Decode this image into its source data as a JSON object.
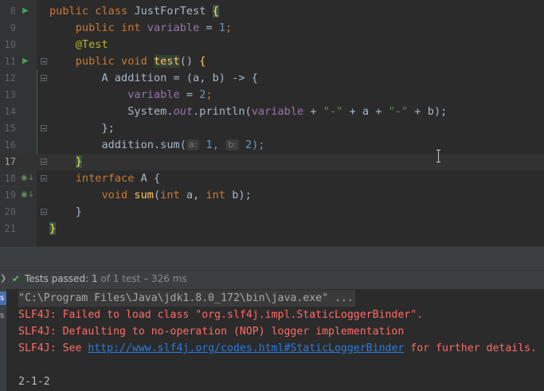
{
  "editor": {
    "lines": [
      {
        "no": "8",
        "gutter_icon": "run"
      },
      {
        "no": "9"
      },
      {
        "no": "10"
      },
      {
        "no": "11",
        "gutter_icon": "run"
      },
      {
        "no": "12"
      },
      {
        "no": "13"
      },
      {
        "no": "14"
      },
      {
        "no": "15"
      },
      {
        "no": "16"
      },
      {
        "no": "17",
        "current": true
      },
      {
        "no": "18",
        "gutter_icon": "implemented"
      },
      {
        "no": "19",
        "gutter_icon": "implemented"
      },
      {
        "no": "20"
      },
      {
        "no": "21"
      }
    ],
    "code": {
      "l8": {
        "kw1": "public",
        "kw2": "class",
        "name": "JustForTest",
        "brace": "{"
      },
      "l9": {
        "kw1": "public",
        "kw2": "int",
        "field": "variable",
        "op": " = ",
        "num": "1",
        "end": ";"
      },
      "l10": {
        "annotation": "@Test"
      },
      "l11": {
        "kw1": "public",
        "kw2": "void",
        "method": "test",
        "rest": "() ",
        "brace": "{"
      },
      "l12": {
        "text": "A addition = (a, b) -> {"
      },
      "l13": {
        "field": "variable",
        "op": " = ",
        "num": "2",
        "end": ";"
      },
      "l14": {
        "cls": "System.",
        "out": "out",
        "mid": ".println(",
        "field": "variable",
        "s1": " + ",
        "str1": "\"-\"",
        "s2": " + a + ",
        "str2": "\"-\"",
        "s3": " + b);"
      },
      "l15": {
        "text": "};"
      },
      "l16": {
        "pre": "addition.sum(",
        "hint_a": "a:",
        "v1": "1, ",
        "hint_b": "b:",
        "v2": "2);"
      },
      "l17": {
        "brace": "}"
      },
      "l18": {
        "kw": "interface",
        "rest": " A {"
      },
      "l19": {
        "kw1": "void",
        "method": "sum",
        "p1": "(",
        "kw2": "int",
        "p2": " a, ",
        "kw3": "int",
        "p3": " b);"
      },
      "l20": {
        "text": "}"
      },
      "l21": {
        "brace": "}"
      }
    }
  },
  "run": {
    "status": {
      "label": "Tests passed:",
      "count": "1",
      "of_text": "of 1 test",
      "duration": "– 326 ms"
    },
    "strip_tabs": [
      "s",
      "s"
    ],
    "console": [
      {
        "type": "cmd",
        "text": "\"C:\\Program Files\\Java\\jdk1.8.0_172\\bin\\java.exe\" ..."
      },
      {
        "type": "err",
        "text": "SLF4J: Failed to load class \"org.slf4j.impl.StaticLoggerBinder\"."
      },
      {
        "type": "err",
        "text": "SLF4J: Defaulting to no-operation (NOP) logger implementation"
      },
      {
        "type": "err_link",
        "pre": "SLF4J: See ",
        "link": "http://www.slf4j.org/codes.html#StaticLoggerBinder",
        "post": " for further details."
      },
      {
        "type": "blank",
        "text": ""
      },
      {
        "type": "out",
        "text": "2-1-2"
      }
    ]
  },
  "colors": {
    "background": "#2b2b2b",
    "keyword": "#cc7832",
    "field": "#9876aa",
    "string": "#6a8759",
    "number": "#6897bb",
    "error": "#ff6b68",
    "link": "#287bde",
    "success": "#5fb85f"
  }
}
